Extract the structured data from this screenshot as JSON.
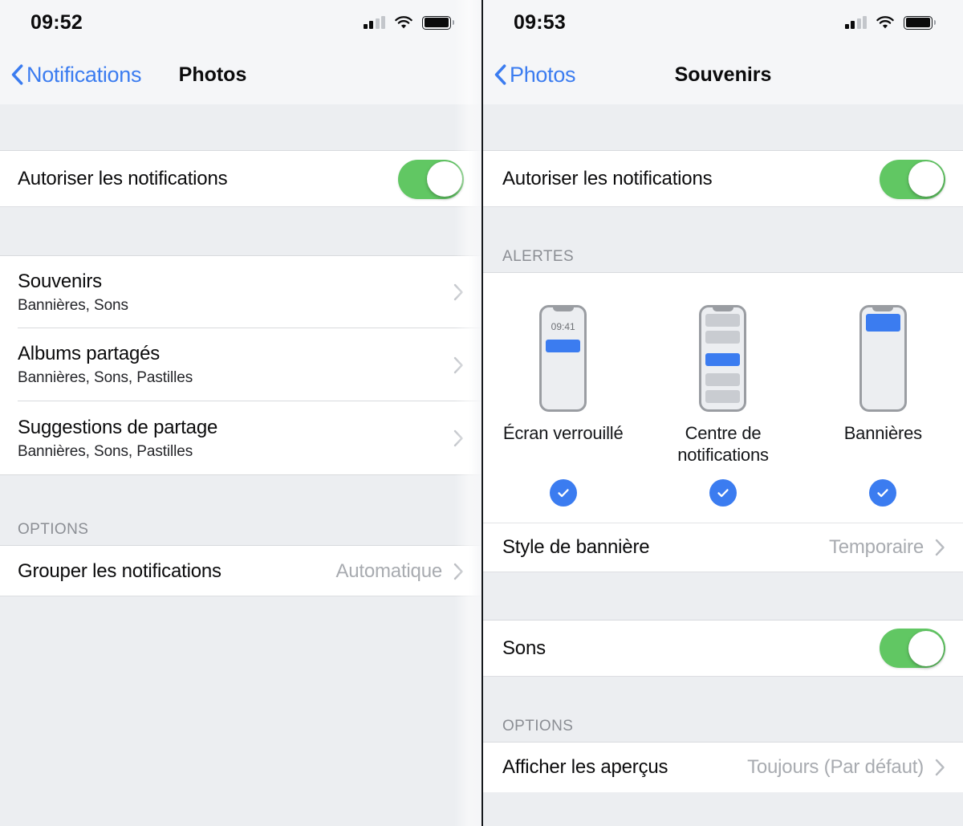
{
  "left_panel": {
    "status_bar": {
      "time": "09:52",
      "icons": [
        "cellular-signal-icon",
        "wifi-icon",
        "battery-icon"
      ]
    },
    "nav": {
      "back_label": "Notifications",
      "back_icon": "chevron-left-icon",
      "title": "Photos"
    },
    "allow_row": {
      "label": "Autoriser les notifications",
      "toggle_state": "on"
    },
    "app_rows": [
      {
        "title": "Souvenirs",
        "subtitle": "Bannières, Sons",
        "accessory": "chevron-right-icon"
      },
      {
        "title": "Albums partagés",
        "subtitle": "Bannières, Sons, Pastilles",
        "accessory": "chevron-right-icon"
      },
      {
        "title": "Suggestions de partage",
        "subtitle": "Bannières, Sons, Pastilles",
        "accessory": "chevron-right-icon"
      }
    ],
    "options_header": "OPTIONS",
    "group_row": {
      "label": "Grouper les notifications",
      "value": "Automatique",
      "accessory": "chevron-right-icon"
    }
  },
  "right_panel": {
    "status_bar": {
      "time": "09:53",
      "icons": [
        "cellular-signal-icon",
        "wifi-icon",
        "battery-icon"
      ]
    },
    "nav": {
      "back_label": "Photos",
      "back_icon": "chevron-left-icon",
      "title": "Souvenirs"
    },
    "allow_row": {
      "label": "Autoriser les notifications",
      "toggle_state": "on"
    },
    "alerts_header": "ALERTES",
    "alerts": [
      {
        "label": "Écran verrouillé",
        "preview_time": "09:41",
        "selected": true
      },
      {
        "label": "Centre de notifications",
        "preview_time": "",
        "selected": true
      },
      {
        "label": "Bannières",
        "preview_time": "",
        "selected": true
      }
    ],
    "banner_style_row": {
      "label": "Style de bannière",
      "value": "Temporaire",
      "accessory": "chevron-right-icon"
    },
    "sounds_row": {
      "label": "Sons",
      "toggle_state": "on"
    },
    "options_header": "OPTIONS",
    "previews_row": {
      "label": "Afficher les aperçus",
      "value": "Toujours (Par défaut)",
      "accessory": "chevron-right-icon"
    }
  },
  "colors": {
    "accent_blue": "#3b7cf0",
    "toggle_green": "#61c763",
    "group_background": "#eceef1",
    "row_background": "#ffffff",
    "secondary_text": "#a8abb0"
  }
}
